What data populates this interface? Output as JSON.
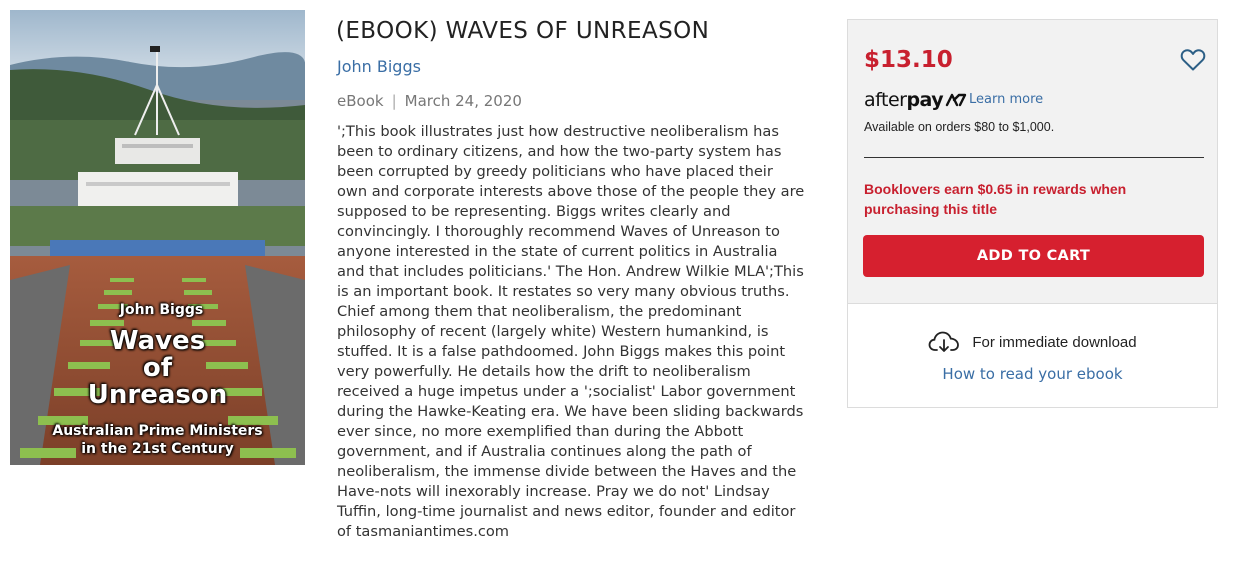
{
  "book": {
    "title": "(EBOOK) WAVES OF UNREASON",
    "author": "John Biggs",
    "format": "eBook",
    "separator": "|",
    "date": "March 24, 2020",
    "description": "';This book illustrates just how destructive neoliberalism has been to ordinary citizens, and how the two-party system has been corrupted by greedy politicians who have placed their own and corporate interests above those of the people they are supposed to be representing. Biggs writes clearly and convincingly. I thoroughly recommend Waves of Unreason to anyone interested in the state of current politics in Australia and that includes politicians.' The Hon. Andrew Wilkie MLA';This is an important book. It restates so very many obvious truths. Chief among them that neoliberalism, the predominant philosophy of recent (largely white) Western humankind, is stuffed. It is a false pathdoomed. John Biggs makes this point very powerfully. He details how the drift to neoliberalism received a huge impetus under a ';socialist' Labor government during the Hawke-Keating era. We have been sliding backwards ever since, no more exemplified than during the Abbott government, and if Australia continues along the path of neoliberalism, the immense divide between the Haves and the Have-nots will inexorably increase. Pray we do not' Lindsay Tuffin, long-time journalist and news editor, founder and editor of tasmaniantimes.com"
  },
  "cover": {
    "author": "John Biggs",
    "title_line1": "Waves",
    "title_line2": "of",
    "title_line3": "Unreason",
    "subtitle_line1": "Australian Prime Ministers",
    "subtitle_line2": "in the 21st Century"
  },
  "purchase": {
    "price": "$13.10",
    "afterpay_brand_bold": "after",
    "afterpay_brand_rest": "pay",
    "afterpay_link": "Learn more",
    "afterpay_note": "Available on orders $80 to $1,000.",
    "rewards": "Booklovers earn $0.65 in rewards when purchasing this title",
    "add_to_cart": "ADD TO CART",
    "download_text": "For immediate download",
    "how_to_read": "How to read your ebook"
  },
  "colors": {
    "accent_red": "#d6202f",
    "price_red": "#c8202f",
    "link_blue": "#3a6ea5",
    "panel_bg": "#f2f2f2"
  },
  "icons": [
    "heart-icon",
    "afterpay-icon",
    "cloud-download-icon"
  ]
}
